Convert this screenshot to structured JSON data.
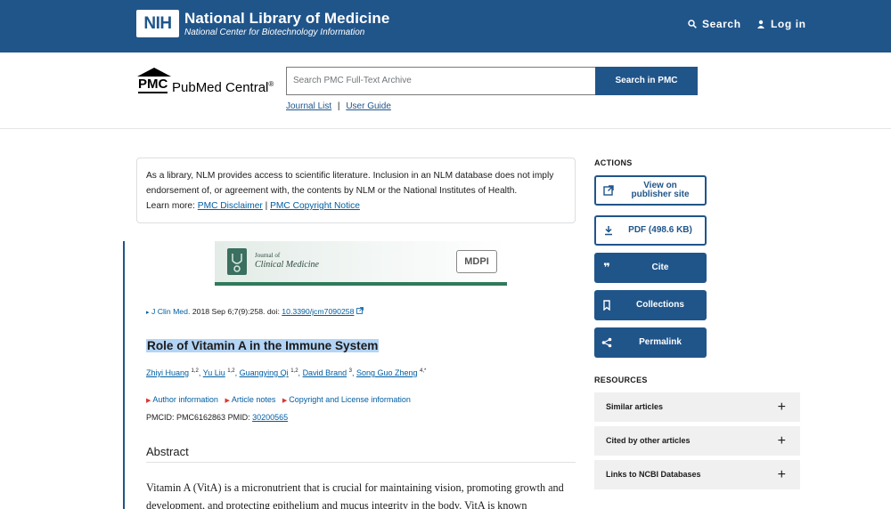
{
  "nih": {
    "logo": "NIH",
    "title": "National Library of Medicine",
    "subtitle": "National Center for Biotechnology Information",
    "search_label": "Search",
    "login_label": "Log in"
  },
  "pmc": {
    "logo_abbrev": "PMC",
    "logo_name": "PubMed Central",
    "logo_reg": "®",
    "search_placeholder": "Search PMC Full-Text Archive",
    "search_button": "Search in PMC",
    "journal_list": "Journal List",
    "separator": "|",
    "user_guide": "User Guide"
  },
  "disclaimer": {
    "text": "As a library, NLM provides access to scientific literature. Inclusion in an NLM database does not imply endorsement of, or agreement with, the contents by NLM or the National Institutes of Health.",
    "learn_more": "Learn more:",
    "link1": "PMC Disclaimer",
    "sep": "|",
    "link2": "PMC Copyright Notice"
  },
  "journal_banner": {
    "line1": "Journal of",
    "line2": "Clinical Medicine",
    "publisher": "MDPI"
  },
  "citation": {
    "journal": "J Clin Med.",
    "details": "2018 Sep 6;7(9):258. doi:",
    "doi": "10.3390/jcm7090258"
  },
  "article": {
    "title": "Role of Vitamin A in the Immune System",
    "authors": [
      {
        "name": "Zhiyi Huang",
        "sup": "1,2"
      },
      {
        "name": "Yu Liu",
        "sup": "1,2"
      },
      {
        "name": "Guangying Qi",
        "sup": "1,2"
      },
      {
        "name": "David Brand",
        "sup": "3"
      },
      {
        "name": "Song Guo Zheng",
        "sup": "4,*"
      }
    ],
    "info_links": [
      "Author information",
      "Article notes",
      "Copyright and License information"
    ],
    "pmcid_label": "PMCID:",
    "pmcid": "PMC6162863",
    "pmid_label": "PMID:",
    "pmid": "30200565"
  },
  "abstract": {
    "heading": "Abstract",
    "text": "Vitamin A (VitA) is a micronutrient that is crucial for maintaining vision, promoting growth and development, and protecting epithelium and mucus integrity in the body. VitA is known"
  },
  "sidebar": {
    "actions_heading": "ACTIONS",
    "view_publisher_1": "View on",
    "view_publisher_2": "publisher site",
    "pdf": "PDF (498.6 KB)",
    "cite": "Cite",
    "collections": "Collections",
    "permalink": "Permalink",
    "resources_heading": "RESOURCES",
    "resources": [
      "Similar articles",
      "Cited by other articles",
      "Links to NCBI Databases"
    ],
    "plus": "+"
  }
}
